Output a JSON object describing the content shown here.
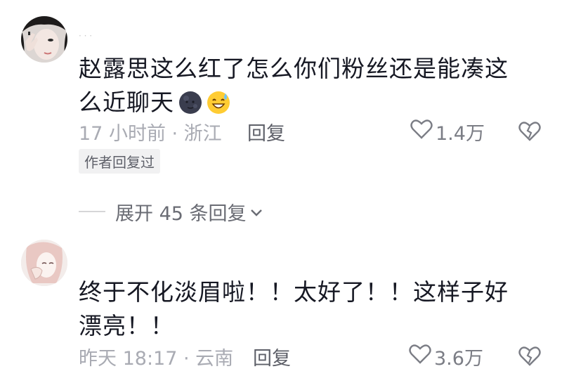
{
  "comments": [
    {
      "username": "· · ·",
      "text_line1": "赵露思这么红了怎么你们粉丝还是能凑这",
      "text_line2": "么近聊天",
      "emojis": [
        "new-moon-face-emoji",
        "grinning-sweat-emoji"
      ],
      "meta": "17 小时前 · 浙江",
      "reply_label": "回复",
      "likes": "1.4万",
      "author_tag": "作者回复过"
    },
    {
      "text_line1": "终于不化淡眉啦！！太好了！！这样子好",
      "text_line2": "漂亮！！",
      "meta": "昨天 18:17 · 云南",
      "reply_label": "回复",
      "likes": "3.6万"
    }
  ],
  "expand_replies_label": "展开 45 条回复",
  "icons": {
    "like": "heart-outline-icon",
    "dislike": "broken-heart-icon",
    "expand": "chevron-down-icon"
  },
  "colors": {
    "meta": "#a9abb3",
    "text": "#161823"
  }
}
